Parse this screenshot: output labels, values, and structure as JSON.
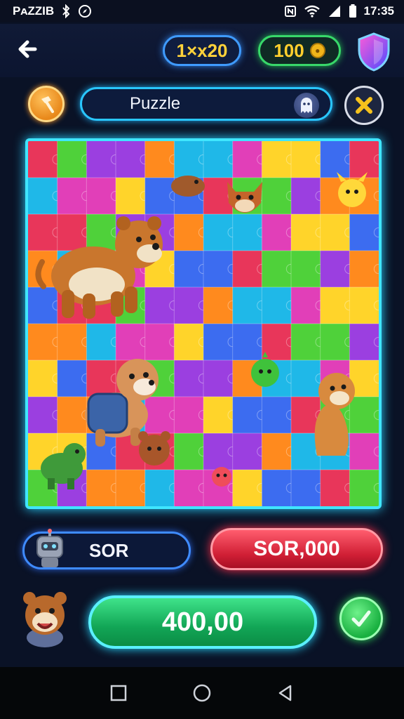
{
  "status_bar": {
    "app_label": "PᴀZZIB",
    "time": "17:35",
    "icons": [
      "bluetooth-icon",
      "compass-icon",
      "nfc-icon",
      "wifi-icon",
      "signal-icon",
      "battery-icon"
    ]
  },
  "header": {
    "level_badge": "1×x20",
    "coins": "100",
    "icons": [
      "back-arrow-icon",
      "coin-icon",
      "shield-icon"
    ]
  },
  "toolbar": {
    "search_value": "Puzzle",
    "icons": [
      "hint-hammer-icon",
      "ghost-icon",
      "close-x-icon"
    ]
  },
  "board": {
    "type": "jigsaw",
    "rows": 10,
    "columns": 12,
    "characters": [
      "bear",
      "dog-with-backpack",
      "weasel",
      "fox",
      "dinosaur",
      "green-bird",
      "yellow-pikachu-like",
      "red-crab",
      "small-brown-critter"
    ]
  },
  "actions": {
    "sor_label": "SOR",
    "sor_button_label": "SOR,000",
    "amount_label": "400,00",
    "icons": [
      "robot-icon",
      "bear-avatar-icon",
      "check-icon"
    ]
  },
  "colors": {
    "background": "#0a1226",
    "accent_cyan": "#3fe6ff",
    "accent_green": "#12a656",
    "accent_red": "#d01f35",
    "coin_yellow": "#ffcf2e"
  },
  "nav": {
    "icons": [
      "recent-apps-icon",
      "home-icon",
      "back-icon"
    ]
  }
}
